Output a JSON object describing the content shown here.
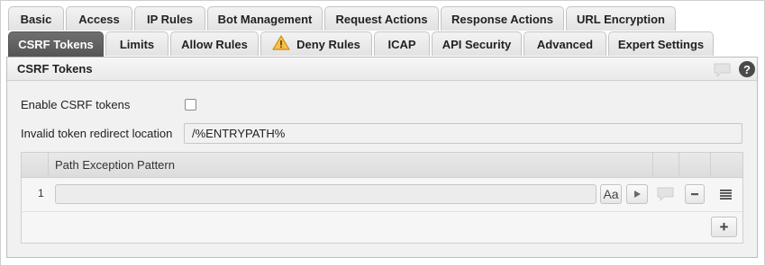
{
  "tabs_row1": [
    "Basic",
    "Access",
    "IP Rules",
    "Bot Management",
    "Request Actions",
    "Response Actions",
    "URL Encryption"
  ],
  "tabs_row2": [
    "CSRF Tokens",
    "Limits",
    "Allow Rules",
    "Deny Rules",
    "ICAP",
    "API Security",
    "Advanced",
    "Expert Settings"
  ],
  "active_tab": "CSRF Tokens",
  "panel": {
    "title": "CSRF Tokens",
    "help": "?"
  },
  "form": {
    "enable_label": "Enable CSRF tokens",
    "enable_checked": false,
    "redirect_label": "Invalid token redirect location",
    "redirect_value": "/%ENTRYPATH%"
  },
  "grid": {
    "column_header": "Path Exception Pattern",
    "rows": [
      {
        "index": "1",
        "pattern": ""
      }
    ],
    "case_button": "Aa",
    "add_button": "+"
  },
  "icons": [
    "warning-icon",
    "comment-icon",
    "help-icon",
    "play-icon",
    "minus-icon",
    "drag-handle-icon",
    "plus-icon"
  ],
  "colors": {
    "active_tab": "#5f5f5f",
    "warning": "#e8a317",
    "panel_bg": "#f1f1f1"
  }
}
